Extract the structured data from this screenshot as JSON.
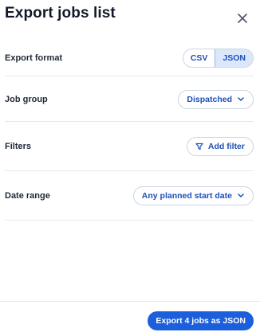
{
  "dialog": {
    "title": "Export jobs list"
  },
  "export_format": {
    "label": "Export format",
    "options": [
      "CSV",
      "JSON"
    ],
    "selected": "JSON"
  },
  "job_group": {
    "label": "Job group",
    "value": "Dispatched"
  },
  "filters": {
    "label": "Filters",
    "button_label": "Add filter"
  },
  "date_range": {
    "label": "Date range",
    "value": "Any planned start date"
  },
  "footer": {
    "export_button_label": "Export 4 jobs as JSON"
  },
  "colors": {
    "accent": "#1c5fdc",
    "link_text": "#1e4fb8",
    "selected_bg": "#dbe7fb"
  },
  "icons": {
    "close": "close-icon",
    "chevron": "chevron-down-icon",
    "filter": "filter-icon"
  }
}
